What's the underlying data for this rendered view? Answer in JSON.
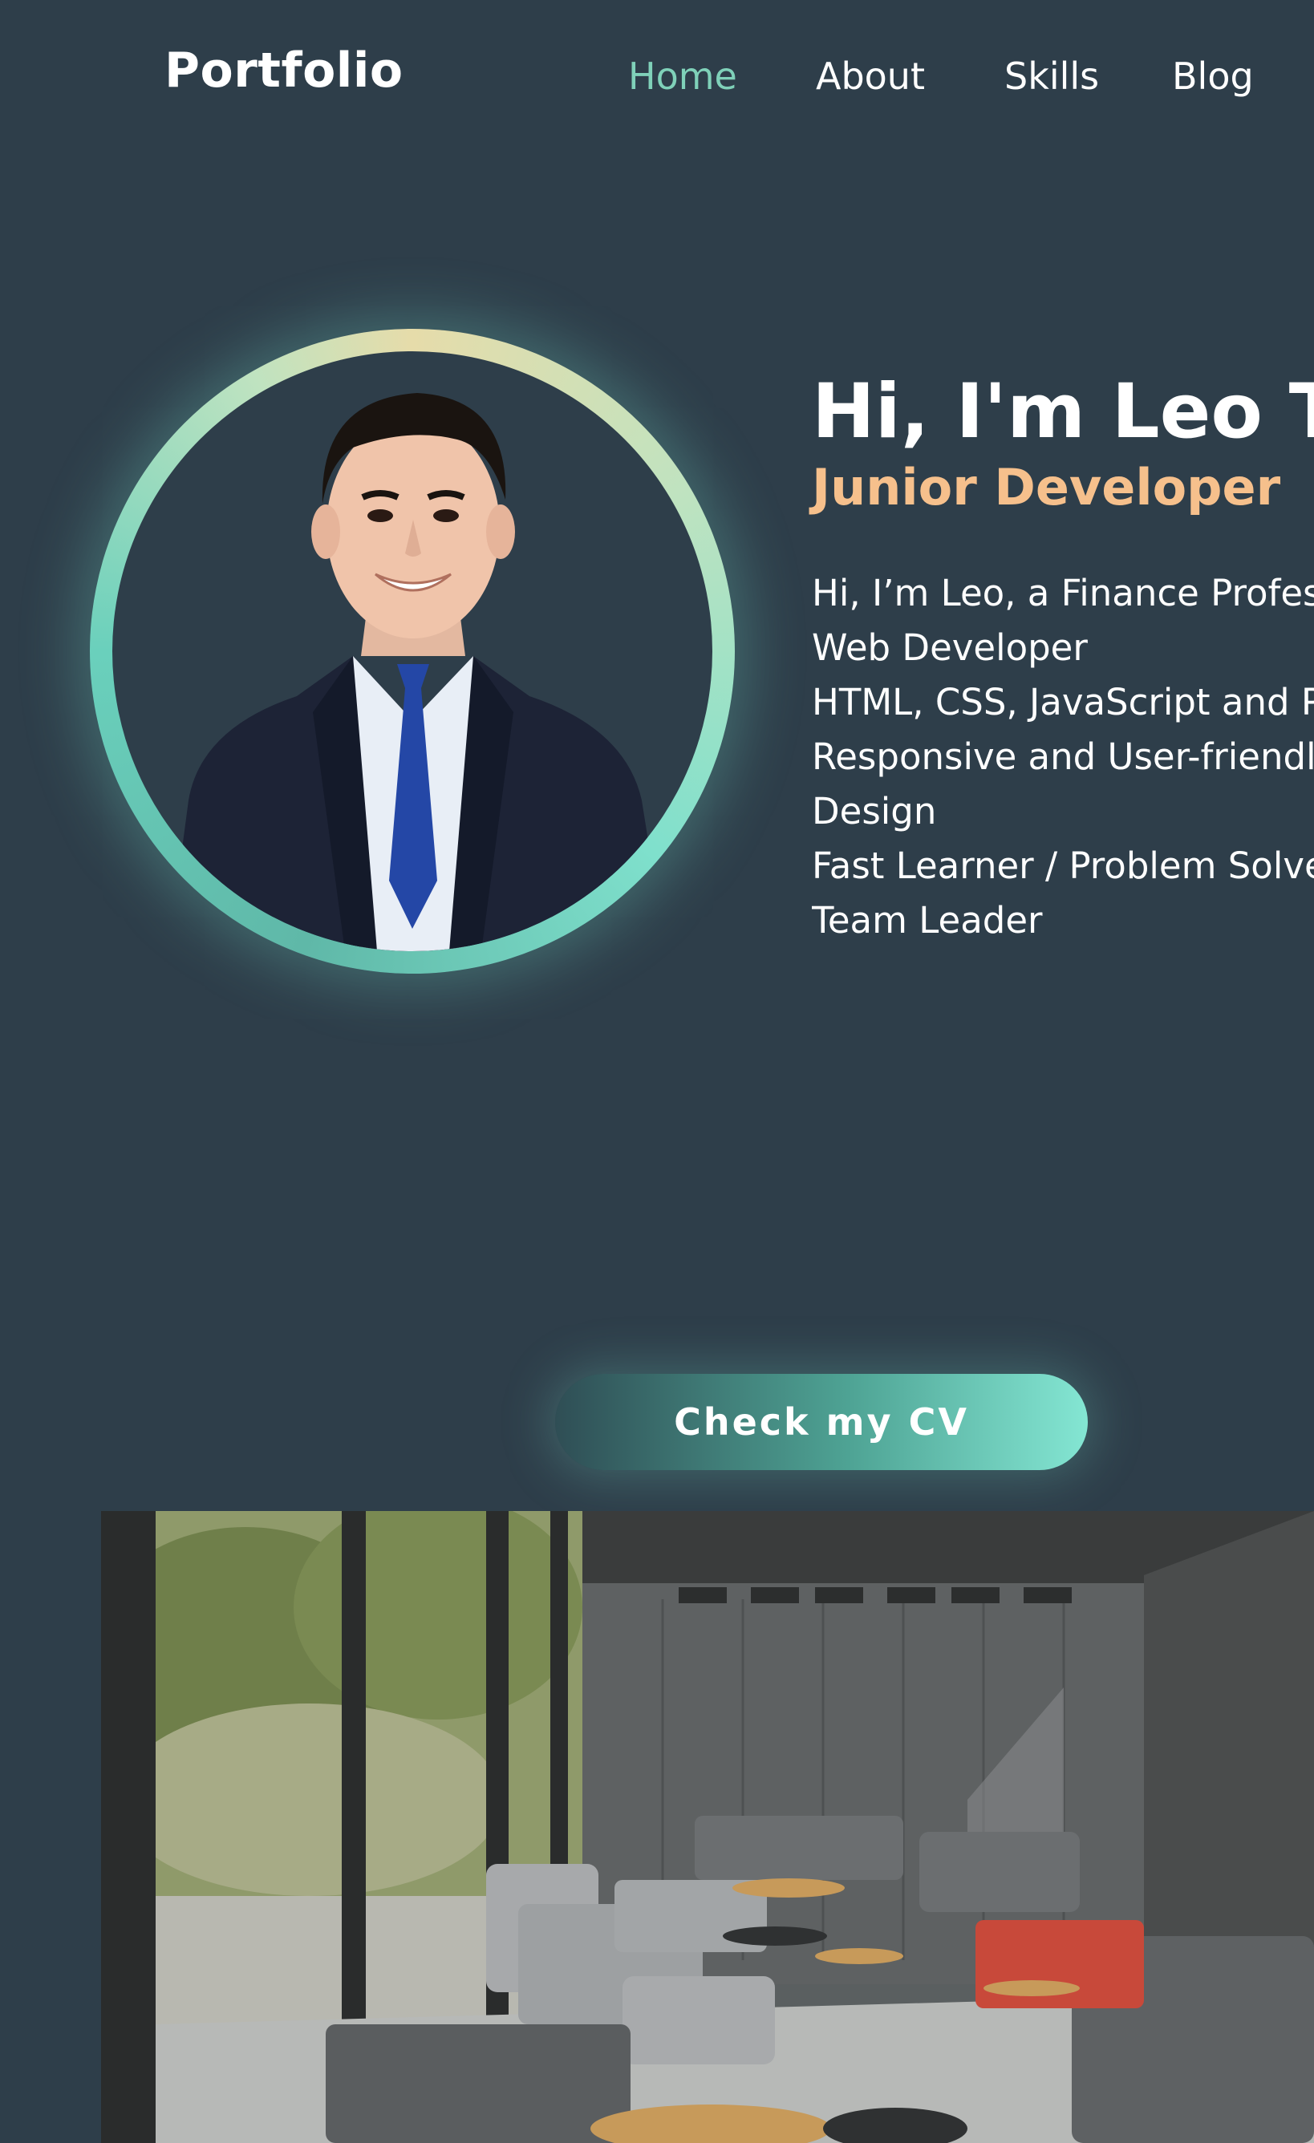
{
  "header": {
    "logo": "Portfolio",
    "nav": [
      {
        "label": "Home",
        "active": true
      },
      {
        "label": "About",
        "active": false
      },
      {
        "label": "Skills",
        "active": false
      },
      {
        "label": "Blog",
        "active": false
      }
    ]
  },
  "hero": {
    "name": "Hi, I'm Leo Tra",
    "role": "Junior Developer",
    "lines": [
      "Hi, I’m Leo, a Finance Profess",
      "Web Developer",
      "HTML, CSS, JavaScript and Py",
      "Responsive and User-friendl",
      "Design",
      "Fast Learner / Problem Solve",
      "Team Leader"
    ]
  },
  "cta": {
    "label": "Check my CV"
  },
  "colors": {
    "background": "#2e3e4a",
    "accent": "#7fd1b9",
    "role": "#f6c08c"
  }
}
